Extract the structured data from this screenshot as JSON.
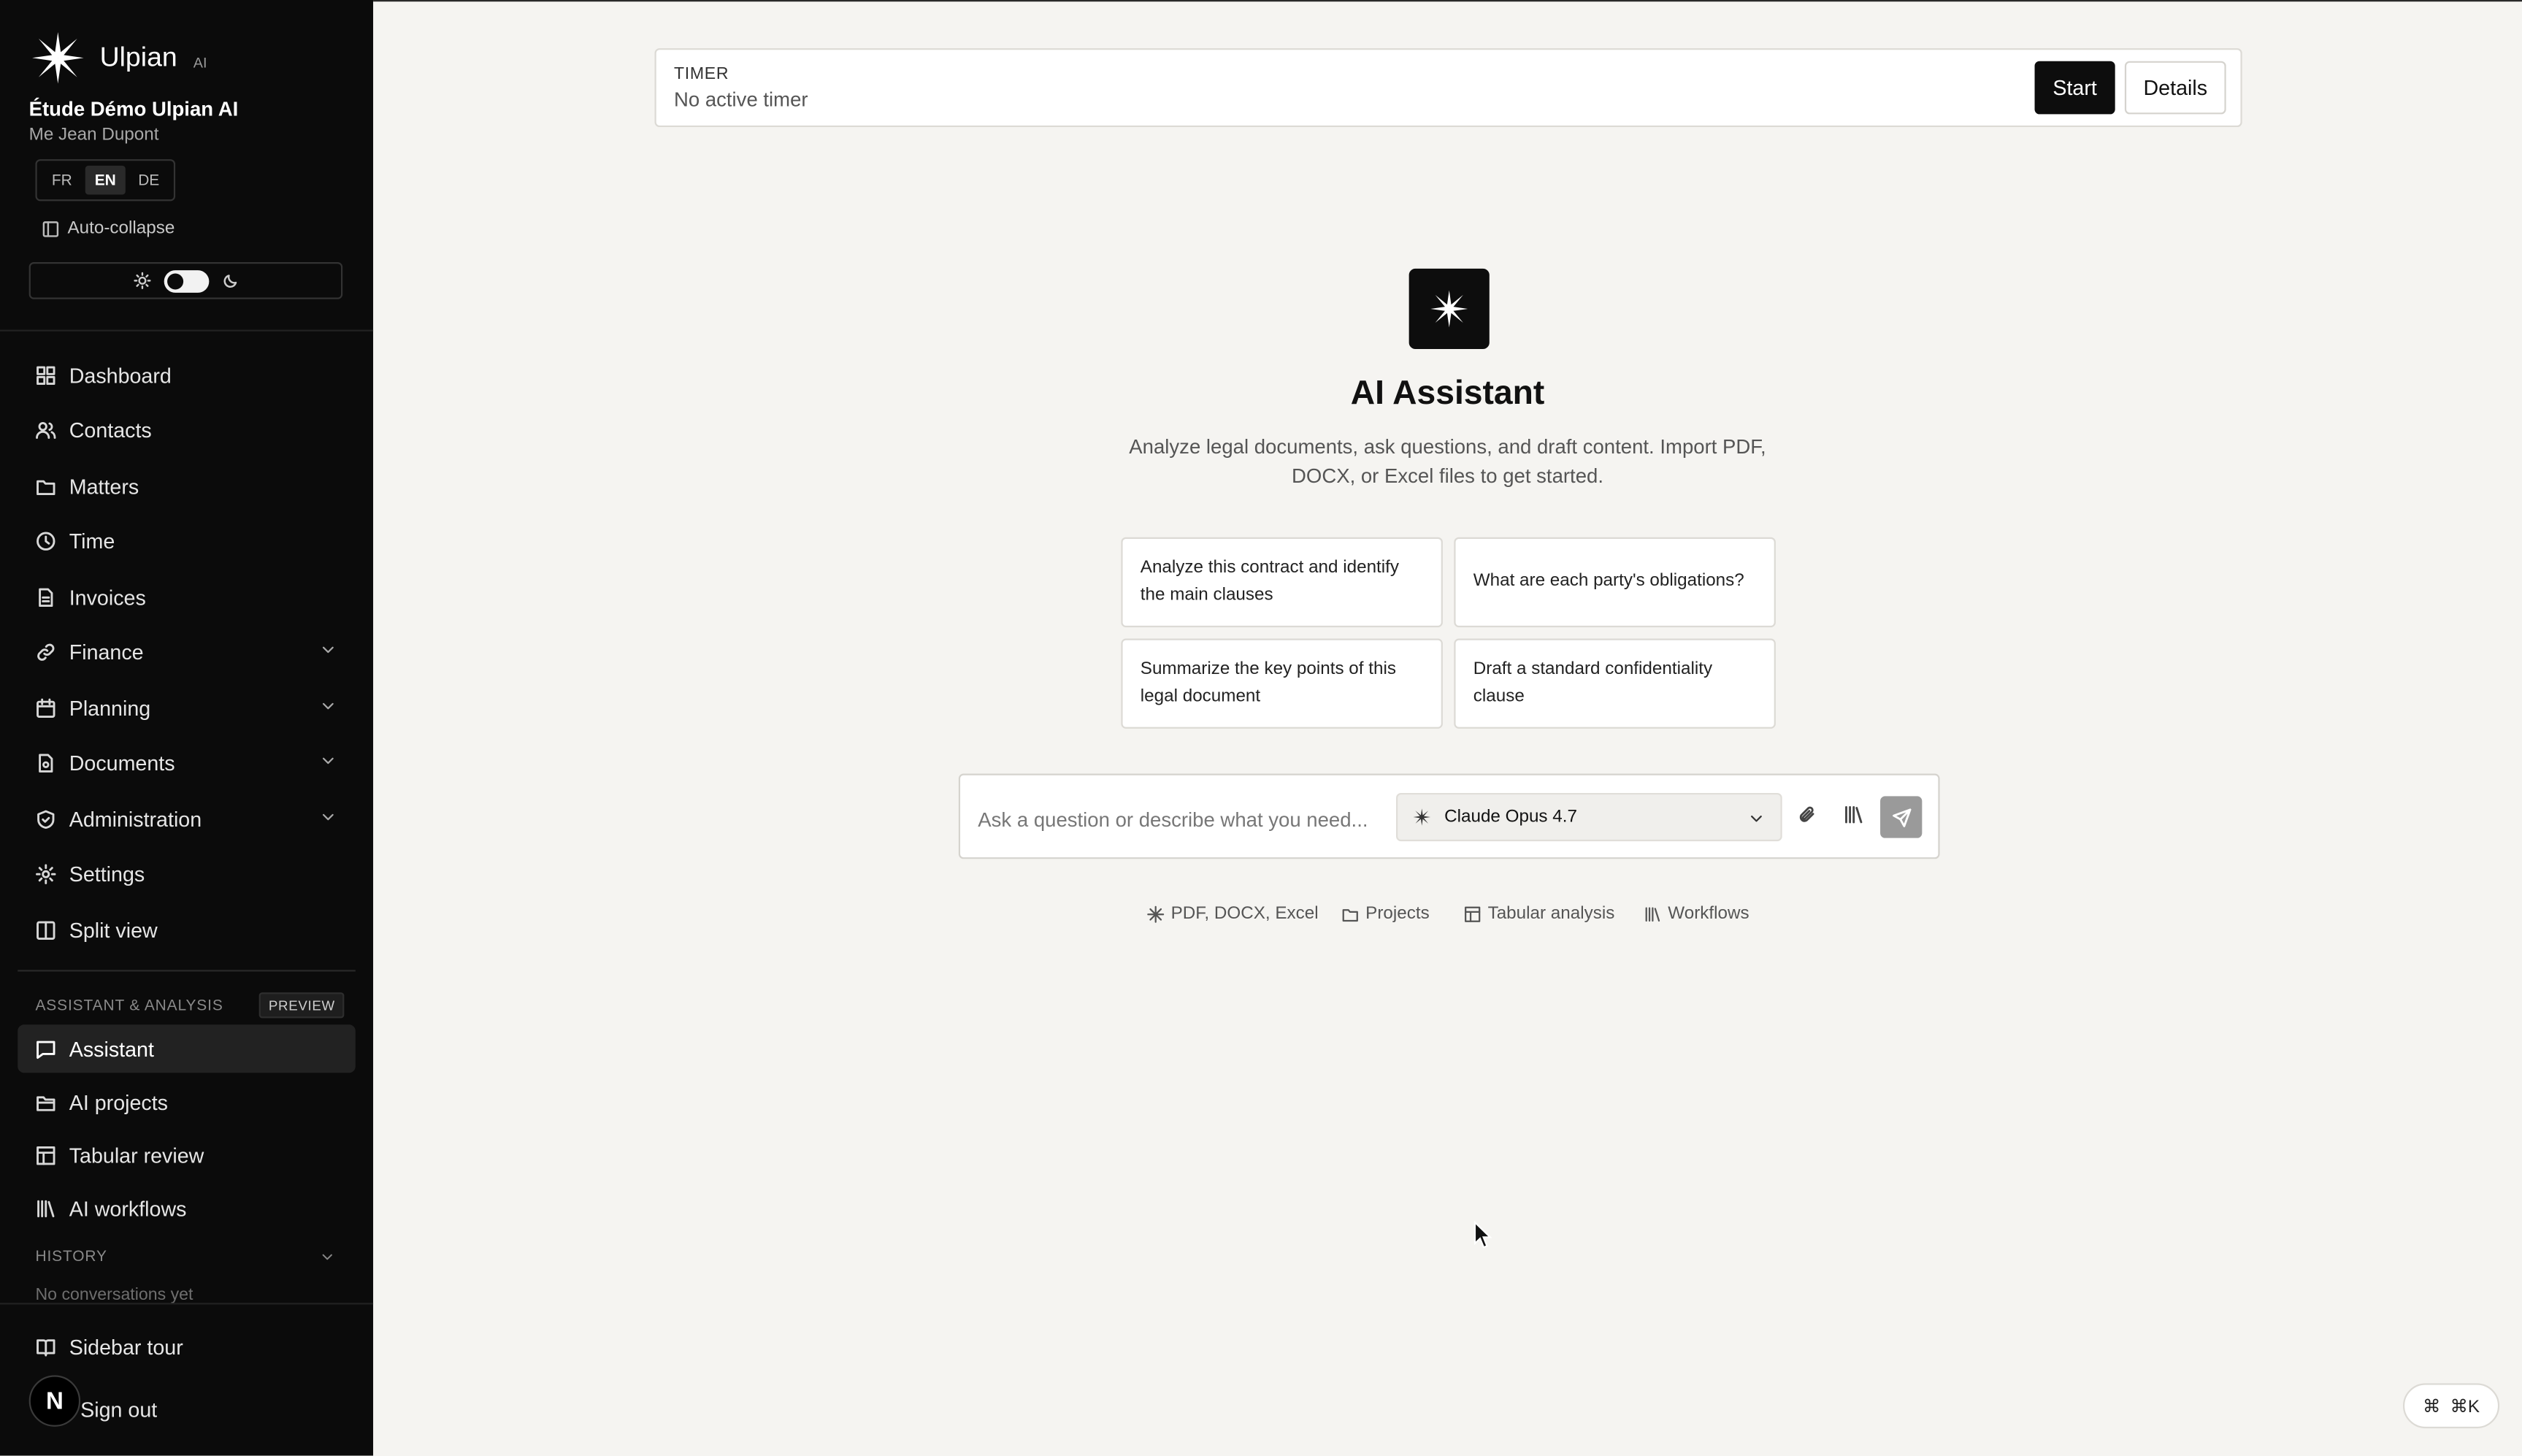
{
  "app": {
    "brand": "Ulpian",
    "brand_suffix": "AI",
    "firm": "Étude Démo Ulpian AI",
    "user": "Me Jean Dupont",
    "languages": [
      "FR",
      "EN",
      "DE"
    ],
    "active_language": "EN",
    "auto_collapse": "Auto-collapse"
  },
  "nav": {
    "items": [
      {
        "label": "Dashboard",
        "icon": "grid-icon"
      },
      {
        "label": "Contacts",
        "icon": "users-icon"
      },
      {
        "label": "Matters",
        "icon": "folder-icon"
      },
      {
        "label": "Time",
        "icon": "clock-icon"
      },
      {
        "label": "Invoices",
        "icon": "file-icon"
      },
      {
        "label": "Finance",
        "icon": "link-icon"
      },
      {
        "label": "Planning",
        "icon": "calendar-icon"
      },
      {
        "label": "Documents",
        "icon": "document-icon"
      },
      {
        "label": "Administration",
        "icon": "shield-icon"
      },
      {
        "label": "Settings",
        "icon": "gear-icon"
      },
      {
        "label": "Split view",
        "icon": "columns-icon"
      }
    ],
    "assistant_section": "ASSISTANT & ANALYSIS",
    "preview_badge": "PREVIEW",
    "assistant_items": [
      {
        "label": "Assistant",
        "icon": "chat-icon"
      },
      {
        "label": "AI projects",
        "icon": "folder-open-icon"
      },
      {
        "label": "Tabular review",
        "icon": "table-icon"
      },
      {
        "label": "AI workflows",
        "icon": "library-icon"
      }
    ],
    "history_label": "HISTORY",
    "history_empty": "No conversations yet",
    "sidebar_tour": "Sidebar tour",
    "avatar_letter": "N",
    "sign_out": "Sign out"
  },
  "timer": {
    "label": "TIMER",
    "value": "No active timer",
    "start": "Start",
    "details": "Details"
  },
  "hero": {
    "title": "AI Assistant",
    "subtitle": "Analyze legal documents, ask questions, and draft content. Import PDF, DOCX, or Excel files to get started."
  },
  "suggestions": [
    "Analyze this contract and identify the main clauses",
    "What are each party's obligations?",
    "Summarize the key points of this legal document",
    "Draft a standard confidentiality clause"
  ],
  "composer": {
    "placeholder": "Ask a question or describe what you need...",
    "model": "Claude Opus 4.7"
  },
  "shortcuts": [
    {
      "label": "PDF, DOCX, Excel",
      "icon": "sparkle-icon"
    },
    {
      "label": "Projects",
      "icon": "folder-icon"
    },
    {
      "label": "Tabular analysis",
      "icon": "table-icon"
    },
    {
      "label": "Workflows",
      "icon": "library-icon"
    }
  ],
  "command_hint": "⌘K",
  "colors": {
    "sidebar": "#0b0b0b",
    "background": "#f5f4f1",
    "primary_button": "#0d0d0d"
  }
}
